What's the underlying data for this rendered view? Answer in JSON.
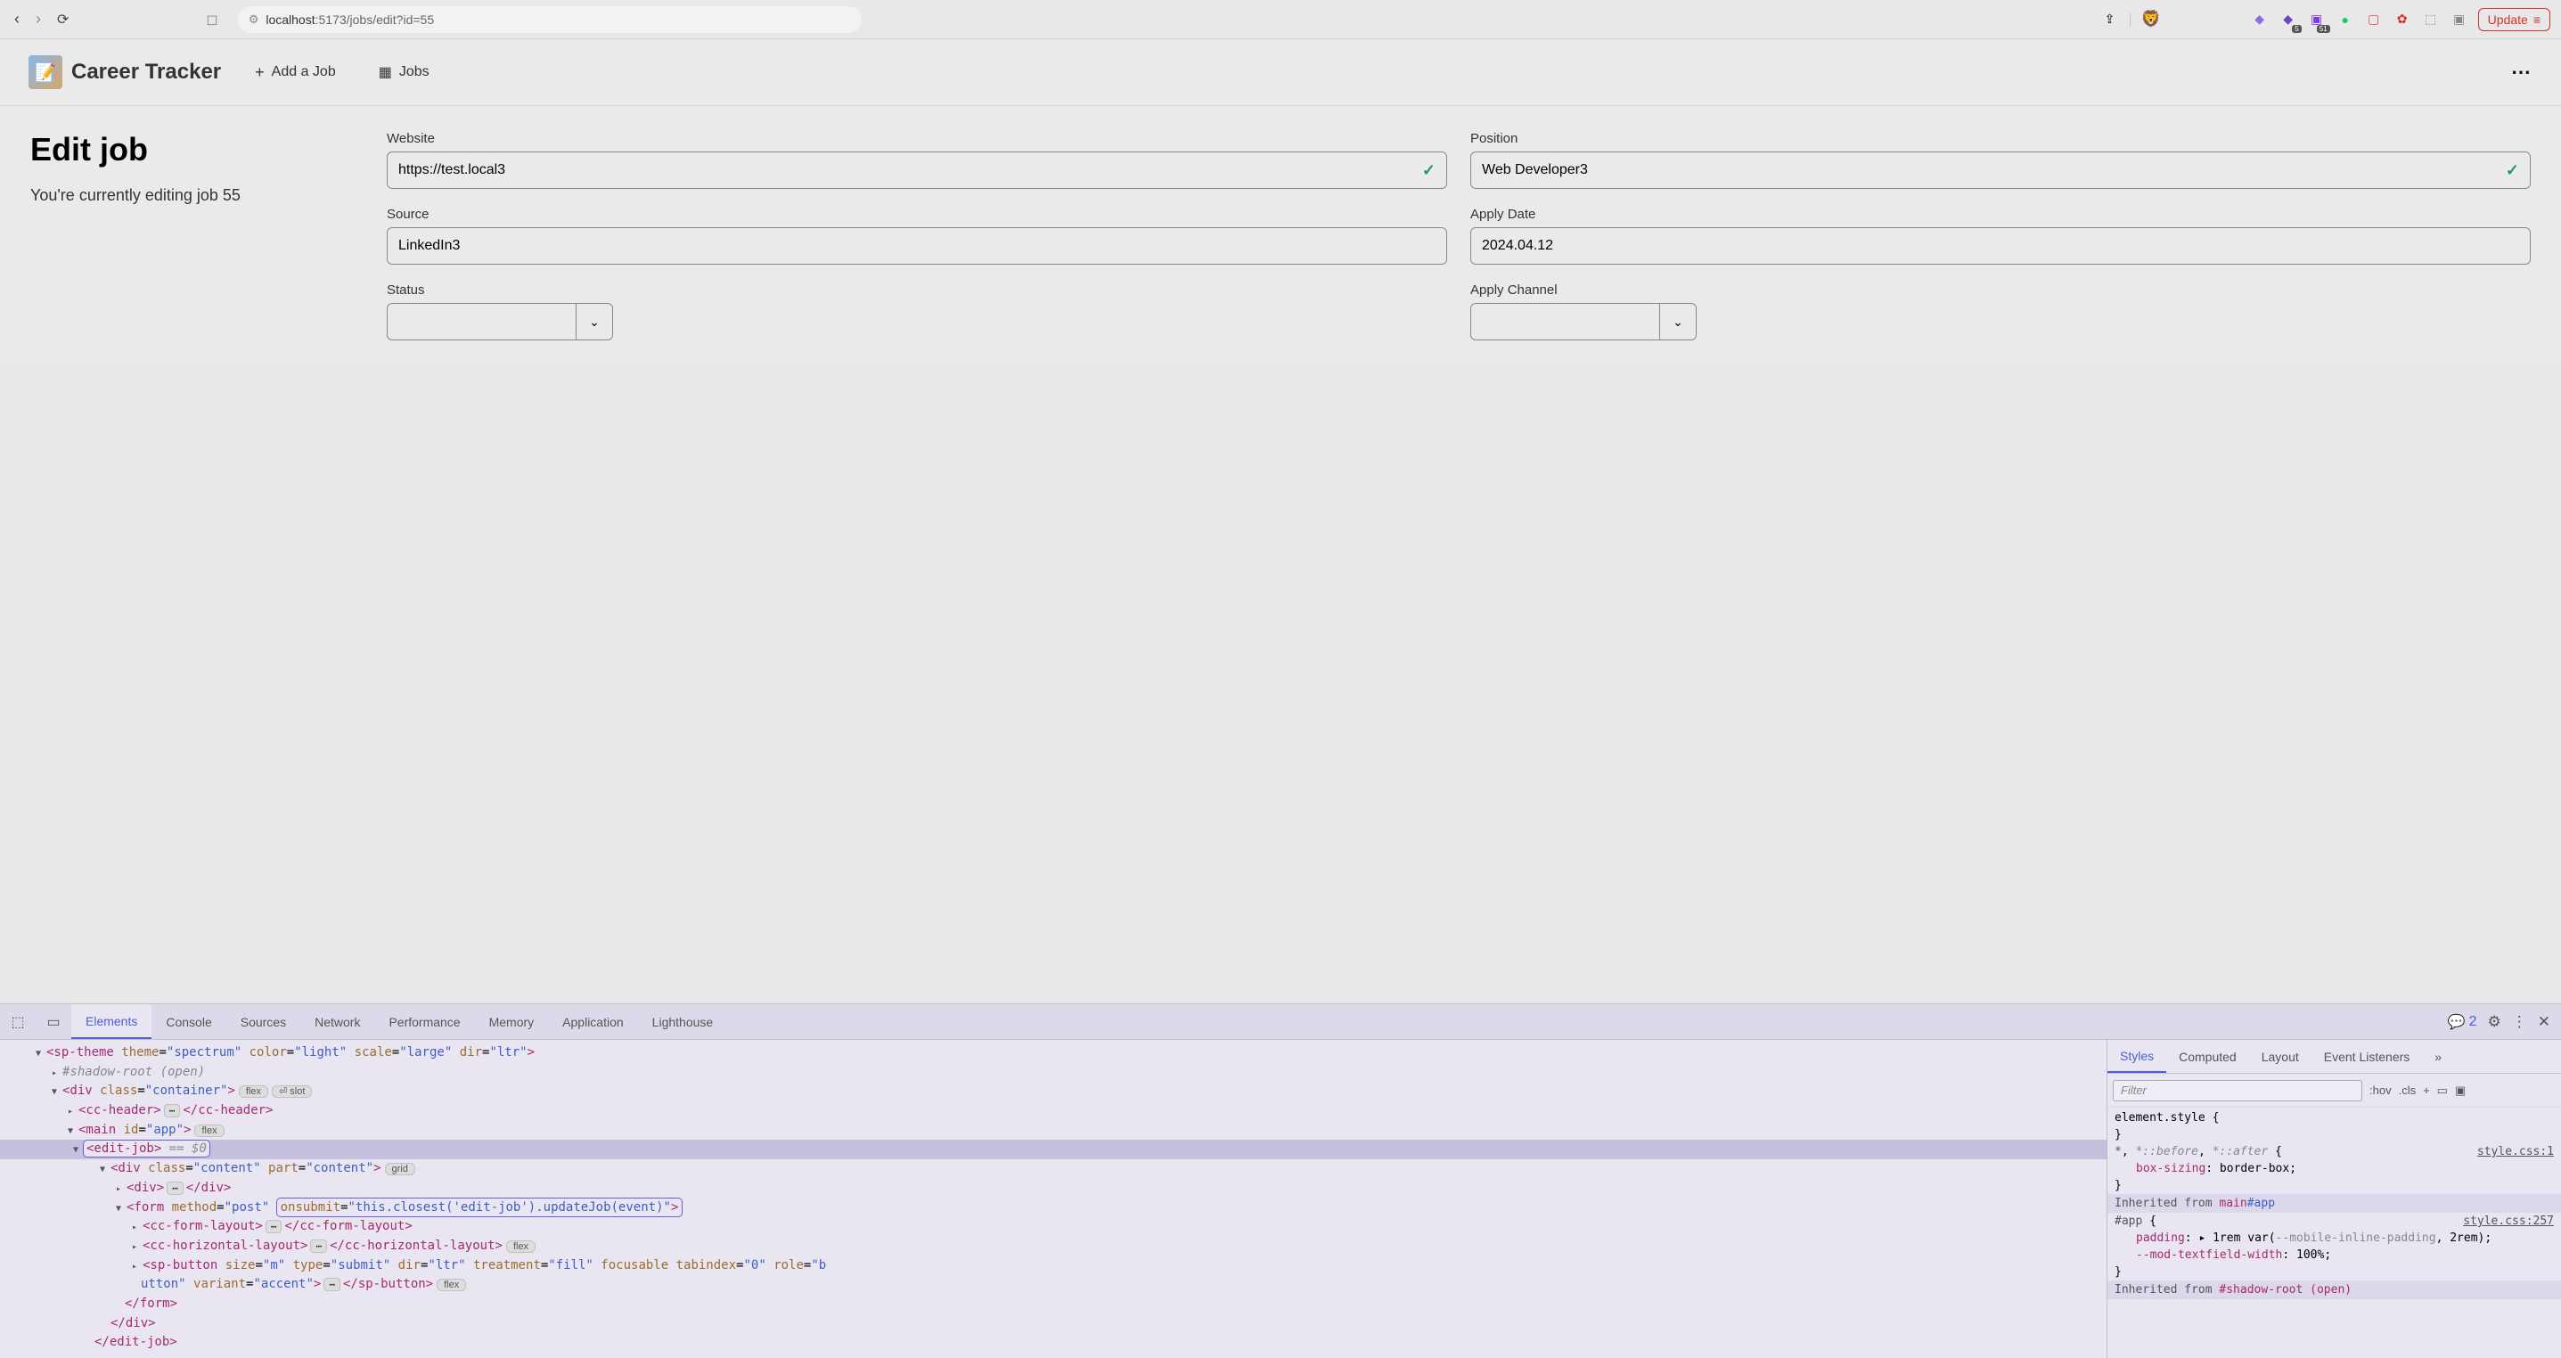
{
  "browser": {
    "url_prefix": "localhost",
    "url_rest": ":5173/jobs/edit?id=55",
    "update_label": "Update",
    "ext_badge_1": "5",
    "ext_badge_2": "51"
  },
  "app": {
    "title": "Career Tracker",
    "nav_add": "Add a Job",
    "nav_jobs": "Jobs"
  },
  "page": {
    "heading": "Edit job",
    "subtitle": "You're currently editing job 55"
  },
  "form": {
    "website": {
      "label": "Website",
      "value": "https://test.local3"
    },
    "position": {
      "label": "Position",
      "value": "Web Developer3"
    },
    "source": {
      "label": "Source",
      "value": "LinkedIn3"
    },
    "apply_date": {
      "label": "Apply Date",
      "value": "2024.04.12"
    },
    "status": {
      "label": "Status",
      "value": ""
    },
    "apply_channel": {
      "label": "Apply Channel",
      "value": ""
    }
  },
  "devtools": {
    "tabs": [
      "Elements",
      "Console",
      "Sources",
      "Network",
      "Performance",
      "Memory",
      "Application",
      "Lighthouse"
    ],
    "msg_count": "2",
    "styles_tabs": [
      "Styles",
      "Computed",
      "Layout",
      "Event Listeners"
    ],
    "filter_placeholder": "Filter",
    "hov": ":hov",
    "cls": ".cls",
    "el_style": "element.style {",
    "brace": "}",
    "star_sel": "*, *::before, *::after {",
    "box_sizing": "box-sizing: border-box;",
    "style_link1": "style.css:1",
    "inherit1": "Inherited from",
    "inherit1_target": "main#app",
    "app_sel": "#app {",
    "style_link2": "style.css:257",
    "padding_line": "padding: ▸ 1rem var(--mobile-inline-padding, 2rem);",
    "mod_line": "--mod-textfield-width: 100%;",
    "inherit2_target": "#shadow-root (open)",
    "dom": {
      "l1": "<sp-theme theme=\"spectrum\" color=\"light\" scale=\"large\" dir=\"ltr\">",
      "l2": "#shadow-root (open)",
      "l3a": "<div class=\"container\">",
      "pill_flex": "flex",
      "pill_slot": "⏎ slot",
      "l4a": "<cc-header>",
      "l4b": "</cc-header>",
      "l5a": "<main id=\"app\">",
      "l6a": "<edit-job>",
      "l6b": "== $0",
      "l7a": "<div class=\"content\" part=\"content\">",
      "pill_grid": "grid",
      "l8a": "<div>",
      "l8b": "</div>",
      "l9a": "<form method=\"post\"",
      "l9b": "onsubmit=\"this.closest('edit-job').updateJob(event)\">",
      "l10a": "<cc-form-layout>",
      "l10b": "</cc-form-layout>",
      "l11a": "<cc-horizontal-layout>",
      "l11b": "</cc-horizontal-layout>",
      "l12": "<sp-button size=\"m\" type=\"submit\" dir=\"ltr\" treatment=\"fill\" focusable tabindex=\"0\" role=\"b",
      "l12b": "utton\" variant=\"accent\">",
      "l12c": "</sp-button>",
      "l13": "</form>",
      "l14": "</div>",
      "l15": "</edit-job>"
    }
  }
}
